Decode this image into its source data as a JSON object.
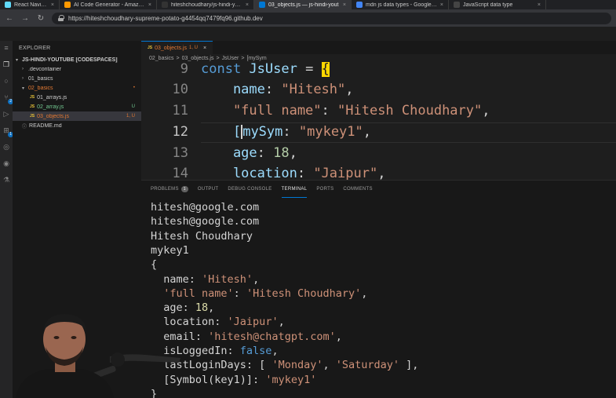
{
  "browser": {
    "tabs": [
      {
        "title": "React Navigation",
        "color": "#61dafb",
        "icon": "react-icon"
      },
      {
        "title": "AI Code Generator - Amazon C",
        "color": "#ff9900",
        "icon": "aws-icon"
      },
      {
        "title": "hiteshchoudhary/js-hindi-yout",
        "color": "#333333",
        "icon": "github-icon"
      },
      {
        "title": "03_objects.js — js-hindi-yout",
        "color": "#0078d4",
        "icon": "codespaces-icon"
      },
      {
        "title": "mdn js data types - Google Se",
        "color": "#4285f4",
        "icon": "google-icon"
      },
      {
        "title": "JavaScript data type",
        "color": "#444444",
        "icon": "mdn-icon"
      }
    ],
    "url": "https://hiteshchoudhary-supreme-potato-g4454qq7479fq96.github.dev"
  },
  "explorer": {
    "title": "EXPLORER",
    "root": "JS-HINDI-YOUTUBE [CODESPACES]",
    "items": [
      {
        "name": ".devcontainer",
        "kind": "folder",
        "status": ""
      },
      {
        "name": "01_basics",
        "kind": "folder",
        "status": ""
      },
      {
        "name": "02_basics",
        "kind": "folder-open",
        "status": "•"
      },
      {
        "name": "01_arrays.js",
        "kind": "file",
        "status": ""
      },
      {
        "name": "02_array.js",
        "kind": "file",
        "status": "U"
      },
      {
        "name": "03_objects.js",
        "kind": "file",
        "status": "1, U"
      },
      {
        "name": "README.md",
        "kind": "info",
        "status": ""
      }
    ]
  },
  "editor": {
    "tab_label": "03_objects.js",
    "tab_status": "1, U",
    "breadcrumbs": [
      "02_basics",
      ">",
      "03_objects.js",
      ">",
      "JsUser",
      ">",
      "[mySym"
    ],
    "lines": [
      {
        "n": "9",
        "parts": [
          [
            "kw",
            "const "
          ],
          [
            "prop",
            "JsUser"
          ],
          [
            "pun",
            " = "
          ],
          [
            "brace",
            "{"
          ]
        ]
      },
      {
        "n": "10",
        "parts": [
          [
            "prop",
            "    name"
          ],
          [
            "pun",
            ": "
          ],
          [
            "str",
            "\"Hitesh\""
          ],
          [
            "pun",
            ","
          ]
        ]
      },
      {
        "n": "11",
        "parts": [
          [
            "str",
            "    \"full name\""
          ],
          [
            "pun",
            ": "
          ],
          [
            "str",
            "\"Hitesh Choudhary\""
          ],
          [
            "pun",
            ","
          ]
        ]
      },
      {
        "n": "12",
        "parts": [
          [
            "pun",
            "    "
          ],
          [
            "brkt",
            "["
          ],
          [
            "prop",
            "mySym"
          ],
          [
            "pun",
            ": "
          ],
          [
            "str",
            "\"mykey1\""
          ],
          [
            "pun",
            ","
          ]
        ]
      },
      {
        "n": "13",
        "parts": [
          [
            "prop",
            "    age"
          ],
          [
            "pun",
            ": "
          ],
          [
            "num",
            "18"
          ],
          [
            "pun",
            ","
          ]
        ]
      },
      {
        "n": "14",
        "parts": [
          [
            "prop",
            "    location"
          ],
          [
            "pun",
            ": "
          ],
          [
            "str",
            "\"Jaipur\""
          ],
          [
            "pun",
            ","
          ]
        ]
      }
    ]
  },
  "panel": {
    "tabs": [
      "PROBLEMS",
      "OUTPUT",
      "DEBUG CONSOLE",
      "TERMINAL",
      "PORTS",
      "COMMENTS"
    ],
    "problems_count": "1",
    "active_tab": "TERMINAL",
    "terminal": [
      [
        [
          "p",
          "hitesh@google.com"
        ]
      ],
      [
        [
          "p",
          "hitesh@google.com"
        ]
      ],
      [
        [
          "p",
          "Hitesh Choudhary"
        ]
      ],
      [
        [
          "p",
          "mykey1"
        ]
      ],
      [
        [
          "p",
          "{"
        ]
      ],
      [
        [
          "p",
          "  name: "
        ],
        [
          "s",
          "'Hitesh'"
        ],
        [
          "p",
          ","
        ]
      ],
      [
        [
          "s",
          "  'full name'"
        ],
        [
          "p",
          ": "
        ],
        [
          "s",
          "'Hitesh Choudhary'"
        ],
        [
          "p",
          ","
        ]
      ],
      [
        [
          "p",
          "  age: "
        ],
        [
          "n",
          "18"
        ],
        [
          "p",
          ","
        ]
      ],
      [
        [
          "p",
          "  location: "
        ],
        [
          "s",
          "'Jaipur'"
        ],
        [
          "p",
          ","
        ]
      ],
      [
        [
          "p",
          "  email: "
        ],
        [
          "s",
          "'hitesh@chatgpt.com'"
        ],
        [
          "p",
          ","
        ]
      ],
      [
        [
          "p",
          "  isLoggedIn: "
        ],
        [
          "k",
          "false"
        ],
        [
          "p",
          ","
        ]
      ],
      [
        [
          "p",
          "  lastLoginDays: [ "
        ],
        [
          "s",
          "'Monday'"
        ],
        [
          "p",
          ", "
        ],
        [
          "s",
          "'Saturday'"
        ],
        [
          "p",
          " ],"
        ]
      ],
      [
        [
          "p",
          "  [Symbol(key1)]: "
        ],
        [
          "s",
          "'mykey1'"
        ]
      ],
      [
        [
          "p",
          "}"
        ]
      ]
    ]
  }
}
